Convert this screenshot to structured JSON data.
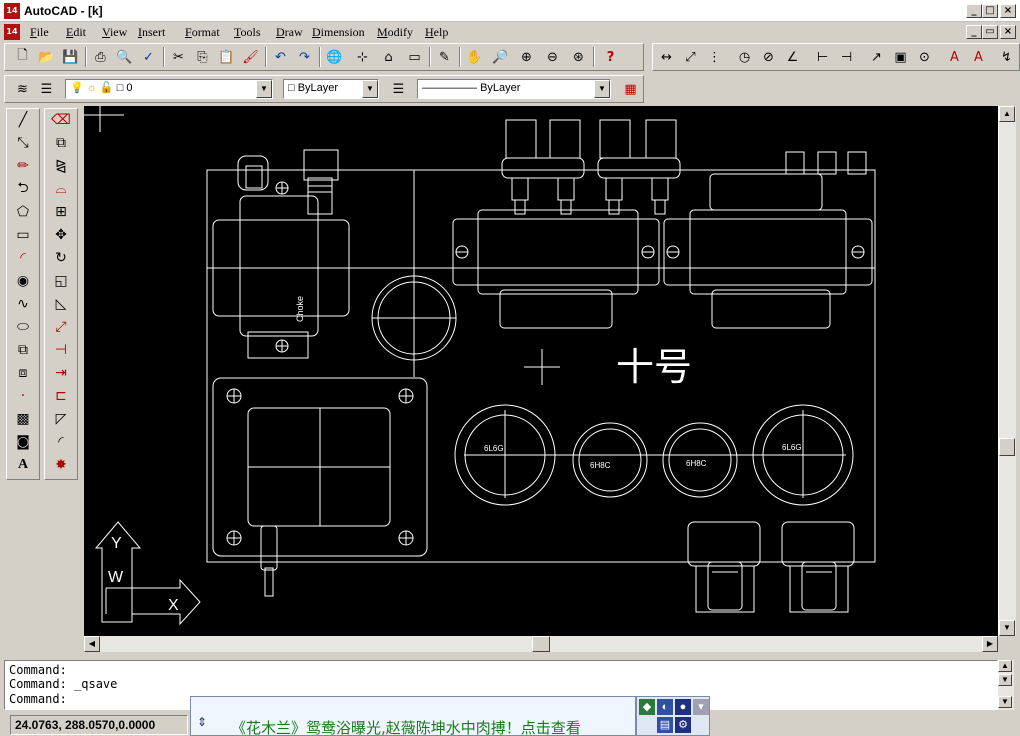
{
  "window": {
    "app_icon": "14",
    "title": "AutoCAD - [k]",
    "controls": [
      "_",
      "□",
      "×"
    ],
    "doc_controls": [
      "_",
      "▭",
      "×"
    ]
  },
  "menu": {
    "doc_icon": "14",
    "items": [
      "File",
      "Edit",
      "View",
      "Insert",
      "Format",
      "Tools",
      "Draw",
      "Dimension",
      "Modify",
      "Help"
    ]
  },
  "properties_bar": {
    "layer_value": "0",
    "color_value": "ByLayer",
    "linetype_value": "ByLayer"
  },
  "drawing": {
    "labels": {
      "choke": "Choke",
      "tube_left_outer": "6L6G",
      "tube_left_inner": "6H8C",
      "tube_right_inner": "6H8C",
      "tube_right_outer": "6L6G",
      "chinese_label": "十号"
    },
    "ucs": {
      "y_label": "Y",
      "w_label": "W",
      "x_label": "X"
    }
  },
  "command": {
    "lines": [
      "Command:",
      "Command: _qsave",
      "Command:"
    ]
  },
  "status": {
    "coordinates": "24.0763, 288.0570,0.0000"
  },
  "ime": {
    "text": "《花木兰》鸳鸯浴曝光,赵薇陈坤水中肉搏！点击查看"
  },
  "colors": {
    "canvas_bg": "#000000",
    "linework": "#ffffff",
    "ime_text": "#1a7a1a"
  }
}
